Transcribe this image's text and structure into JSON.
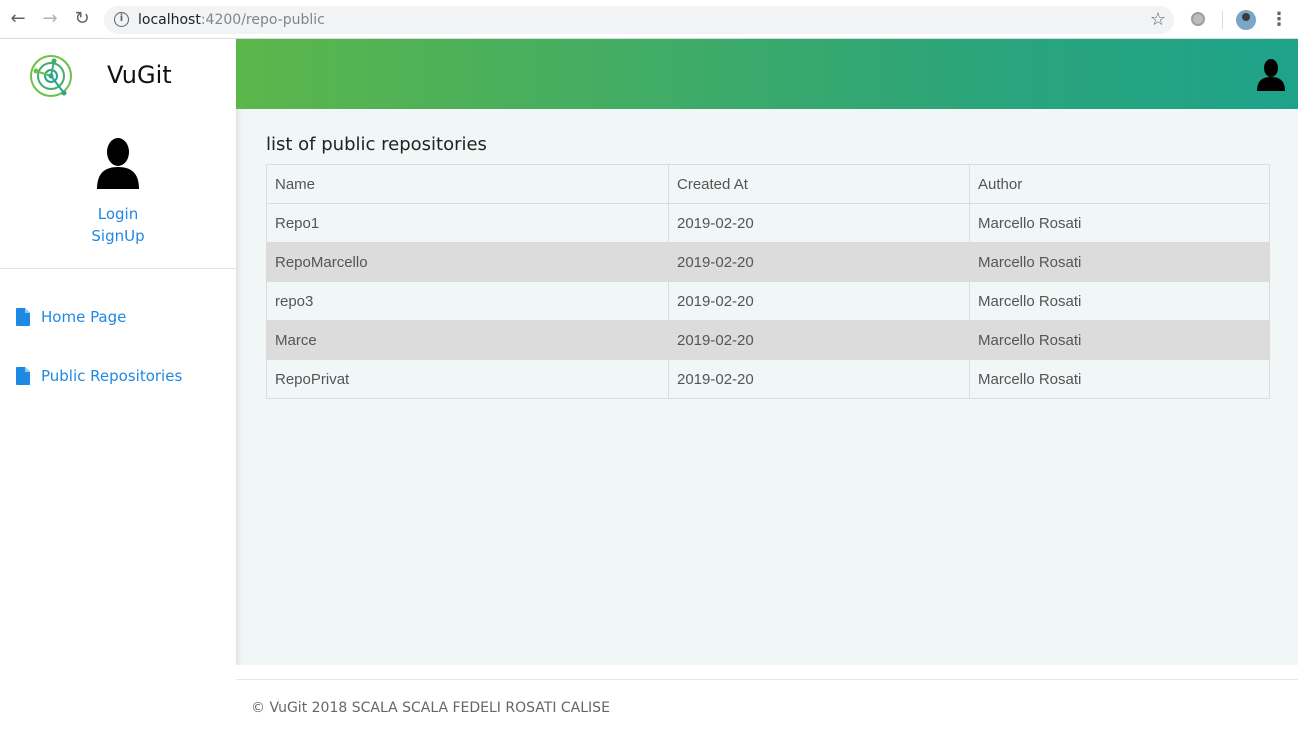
{
  "browser": {
    "url_host": "localhost",
    "url_path": ":4200/repo-public",
    "back_icon": "arrow-left-icon",
    "forward_icon": "arrow-right-icon",
    "reload_icon": "reload-icon"
  },
  "sidebar": {
    "brand": "VuGit",
    "login_label": "Login",
    "signup_label": "SignUp",
    "items": [
      {
        "label": "Home Page",
        "icon": "document-icon"
      },
      {
        "label": "Public Repositories",
        "icon": "document-icon"
      }
    ]
  },
  "colors": {
    "accent_link": "#1e88e5",
    "header_gradient_start": "#5cb64b",
    "header_gradient_end": "#1ea38a",
    "alt_row": "#dcdcdc"
  },
  "main": {
    "heading": "list of public repositories",
    "table": {
      "headers": [
        "Name",
        "Created At",
        "Author"
      ],
      "rows": [
        {
          "name": "Repo1",
          "created_at": "2019-02-20",
          "author": "Marcello Rosati"
        },
        {
          "name": "RepoMarcello",
          "created_at": "2019-02-20",
          "author": "Marcello Rosati"
        },
        {
          "name": "repo3",
          "created_at": "2019-02-20",
          "author": "Marcello Rosati"
        },
        {
          "name": "Marce",
          "created_at": "2019-02-20",
          "author": "Marcello Rosati"
        },
        {
          "name": "RepoPrivat",
          "created_at": "2019-02-20",
          "author": "Marcello Rosati"
        }
      ]
    }
  },
  "footer": {
    "text": "© VuGit 2018 SCALA SCALA FEDELI ROSATI CALISE"
  }
}
